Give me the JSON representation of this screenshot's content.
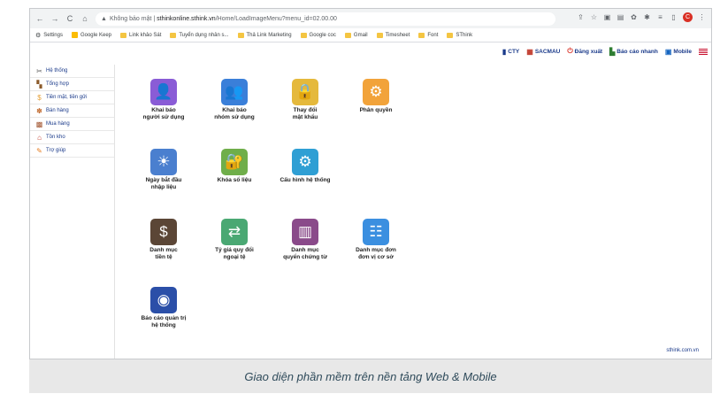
{
  "browser": {
    "nav": [
      "←",
      "→",
      "C",
      "⌂"
    ],
    "security_label": "Không bảo mật",
    "url_host": "sthinkonline.sthink.vn",
    "url_path": "/Home/LoadImageMenu?menu_id=02.00.00",
    "avatar_letter": "C"
  },
  "bookmarks": [
    {
      "label": "Settings",
      "icon": "gear-icon"
    },
    {
      "label": "Google Keep",
      "icon": "keep-icon"
    },
    {
      "label": "Link khảo Sát",
      "icon": "folder-icon"
    },
    {
      "label": "Tuyển dụng nhân s...",
      "icon": "folder-icon"
    },
    {
      "label": "Thả Link Marketing",
      "icon": "folder-icon"
    },
    {
      "label": "Google coc",
      "icon": "folder-icon"
    },
    {
      "label": "Gmail",
      "icon": "folder-icon"
    },
    {
      "label": "Timesheet",
      "icon": "folder-icon"
    },
    {
      "label": "Font",
      "icon": "folder-icon"
    },
    {
      "label": "SThink",
      "icon": "folder-icon"
    }
  ],
  "topnav": {
    "cty": "CTY",
    "sacmau": "SACMAU",
    "logout": "Đăng xuất",
    "quick_report": "Báo cáo nhanh",
    "mobile": "Mobile"
  },
  "sidebar": [
    {
      "label": "Hệ thống",
      "icon": "tools-icon"
    },
    {
      "label": "Tổng hợp",
      "icon": "summary-icon"
    },
    {
      "label": "Tiền mặt, tiền gửi",
      "icon": "money-icon"
    },
    {
      "label": "Bán hàng",
      "icon": "sales-icon"
    },
    {
      "label": "Mua hàng",
      "icon": "purchase-icon"
    },
    {
      "label": "Tồn kho",
      "icon": "warehouse-icon"
    },
    {
      "label": "Trợ giúp",
      "icon": "help-icon"
    }
  ],
  "tiles": [
    {
      "l1": "Khai báo",
      "l2": "người sử dụng",
      "icon": "user-icon",
      "color": "#8a5cd6"
    },
    {
      "l1": "Khai báo",
      "l2": "nhóm sử dụng",
      "icon": "users-icon",
      "color": "#3a7fd9"
    },
    {
      "l1": "Thay đổi",
      "l2": "mật khẩu",
      "icon": "lock-icon",
      "color": "#e5b93c"
    },
    {
      "l1": "Phân quyền",
      "l2": "",
      "icon": "permission-icon",
      "color": "#f2a33a"
    },
    {
      "l1": "Ngày bắt đầu",
      "l2": "nhập liệu",
      "icon": "calendar-icon",
      "color": "#4a7fcf"
    },
    {
      "l1": "Khóa sổ liệu",
      "l2": "",
      "icon": "lock-book-icon",
      "color": "#6fae4a"
    },
    {
      "l1": "Cấu hình hệ thống",
      "l2": "",
      "icon": "config-icon",
      "color": "#2f9fd4"
    },
    {
      "l1": "Danh mục",
      "l2": "tiền tệ",
      "icon": "currency-icon",
      "color": "#5b4636"
    },
    {
      "l1": "Tỷ giá quy đổi",
      "l2": "ngoại tệ",
      "icon": "exchange-icon",
      "color": "#4aa873"
    },
    {
      "l1": "Danh mục",
      "l2": "quyển chứng từ",
      "icon": "books-icon",
      "color": "#8a4a8a"
    },
    {
      "l1": "Danh mục đơn",
      "l2": "đơn vị cơ sở",
      "icon": "org-unit-icon",
      "color": "#3b8fe0"
    },
    {
      "l1": "Báo cáo quản trị",
      "l2": "hệ thống",
      "icon": "report-icon",
      "color": "#2b4fa8"
    }
  ],
  "footer_brand": "sthink.com.vn",
  "caption": "Giao diện phần mềm trên nền tảng Web & Mobile"
}
